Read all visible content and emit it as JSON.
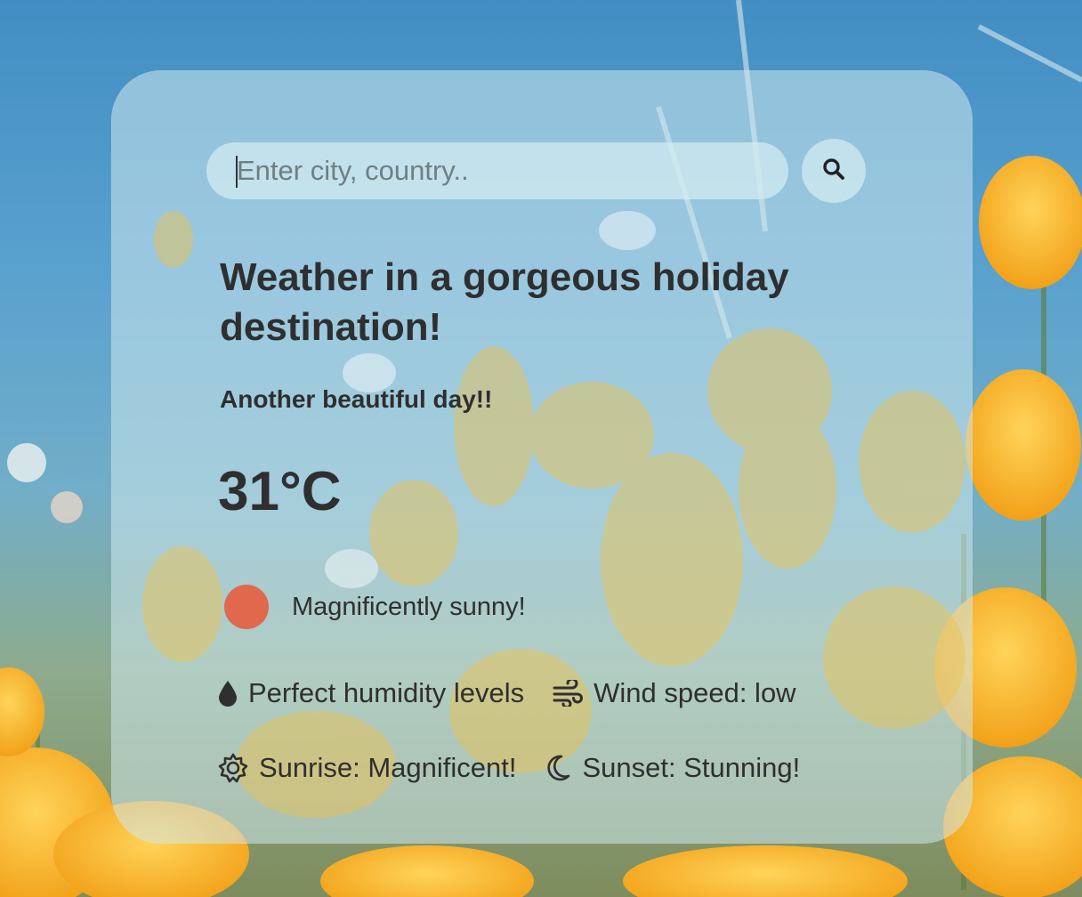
{
  "search": {
    "placeholder": "Enter city, country..",
    "value": ""
  },
  "weather": {
    "title": "Weather in a gorgeous holiday destination!",
    "subtitle": "Another beautiful day!!",
    "temperature": "31°C",
    "condition": "Magnificently sunny!",
    "condition_icon_color": "#e0684d",
    "humidity": "Perfect humidity levels",
    "wind": "Wind speed: low",
    "sunrise": "Sunrise: Magnificent!",
    "sunset": "Sunset: Stunning!"
  },
  "icons": {
    "search": "search-icon",
    "humidity": "droplet-icon",
    "wind": "wind-icon",
    "sunrise": "sun-outline-icon",
    "sunset": "moon-icon"
  },
  "colors": {
    "text": "#2f2f2f",
    "card": "rgba(205,232,236,0.55)"
  }
}
